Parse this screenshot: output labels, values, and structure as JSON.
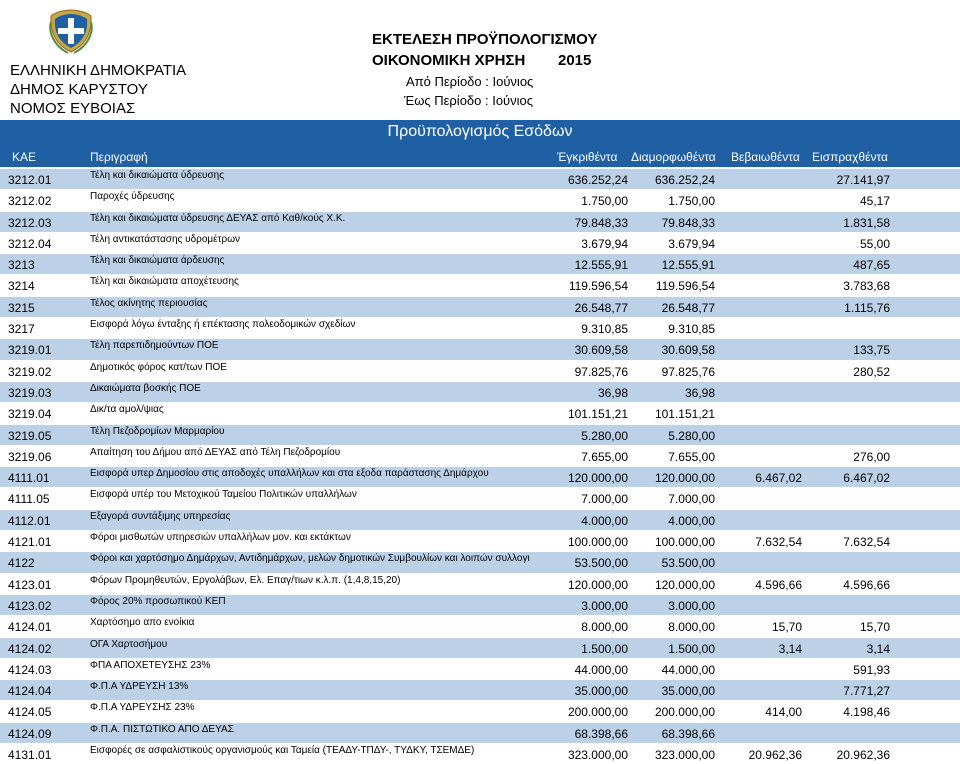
{
  "header": {
    "org_lines": [
      "ΕΛΛΗΝΙΚΗ ΔΗΜΟΚΡΑΤΙΑ",
      "ΔΗΜΟΣ ΚΑΡΥΣΤΟΥ",
      "ΝΟΜΟΣ ΕΥΒΟΙΑΣ"
    ],
    "report_title": "ΕΚΤΕΛΕΣΗ ΠΡΟΫΠΟΛΟΓΙΣΜΟΥ",
    "fiscal_label": "ΟΙΚΟΝΟΜΙΚΗ ΧΡΗΣΗ",
    "year": "2015",
    "from_period": "Από Περίοδο : Ιούνιος",
    "to_period": "Έως Περίοδο : Ιούνιος"
  },
  "section_title": "Προϋπολογισμός Εσόδων",
  "columns": {
    "kae": "ΚΑΕ",
    "description": "Περιγραφή",
    "approved": "Έγκριθέντα",
    "shaped": "Διαμορφωθέντα",
    "confirmed": "Βεβαιωθέντα",
    "collected": "Εισπραχθέντα"
  },
  "colors": {
    "band": "#1f5fa3",
    "alt_row": "#bcd0e7"
  },
  "rows": [
    {
      "kae": "3212.01",
      "desc": "Τέλη και δικαιώματα ύδρευσης",
      "approved": "636.252,24",
      "shaped": "636.252,24",
      "confirmed": "",
      "collected": "27.141,97"
    },
    {
      "kae": "3212.02",
      "desc": "Παροχές ύδρευσης",
      "approved": "1.750,00",
      "shaped": "1.750,00",
      "confirmed": "",
      "collected": "45,17"
    },
    {
      "kae": "3212.03",
      "desc": "Τέλη και δικαιώματα ύδρευσης ΔΕΥΑΣ από Καθ/κούς Χ.Κ.",
      "approved": "79.848,33",
      "shaped": "79.848,33",
      "confirmed": "",
      "collected": "1.831,58"
    },
    {
      "kae": "3212.04",
      "desc": "Τέλη αντικατάστασης υδρομέτρων",
      "approved": "3.679,94",
      "shaped": "3.679,94",
      "confirmed": "",
      "collected": "55,00"
    },
    {
      "kae": "3213",
      "desc": "Τέλη και δικαιώματα άρδευσης",
      "approved": "12.555,91",
      "shaped": "12.555,91",
      "confirmed": "",
      "collected": "487,65"
    },
    {
      "kae": "3214",
      "desc": "Τέλη και δικαιώματα αποχέτευσης",
      "approved": "119.596,54",
      "shaped": "119.596,54",
      "confirmed": "",
      "collected": "3.783,68"
    },
    {
      "kae": "3215",
      "desc": "Τέλος ακίνητης περιουσίας",
      "approved": "26.548,77",
      "shaped": "26.548,77",
      "confirmed": "",
      "collected": "1.115,76"
    },
    {
      "kae": "3217",
      "desc": "Εισφορά λόγω ένταξης ή επέκτασης πολεοδομικών σχεδίων",
      "approved": "9.310,85",
      "shaped": "9.310,85",
      "confirmed": "",
      "collected": ""
    },
    {
      "kae": "3219.01",
      "desc": "Τέλη παρεπιδημούντων ΠΟΕ",
      "approved": "30.609,58",
      "shaped": "30.609,58",
      "confirmed": "",
      "collected": "133,75"
    },
    {
      "kae": "3219.02",
      "desc": "Δημοτικός φόρος κατ/των ΠΟΕ",
      "approved": "97.825,76",
      "shaped": "97.825,76",
      "confirmed": "",
      "collected": "280,52"
    },
    {
      "kae": "3219.03",
      "desc": "Δικαιώματα βοσκής ΠΟΕ",
      "approved": "36,98",
      "shaped": "36,98",
      "confirmed": "",
      "collected": ""
    },
    {
      "kae": "3219.04",
      "desc": "Δικ/τα αμολ/ψιας",
      "approved": "101.151,21",
      "shaped": "101.151,21",
      "confirmed": "",
      "collected": ""
    },
    {
      "kae": "3219.05",
      "desc": "Τέλη Πεζοδρομίων Μαρμαρίου",
      "approved": "5.280,00",
      "shaped": "5.280,00",
      "confirmed": "",
      "collected": ""
    },
    {
      "kae": "3219.06",
      "desc": "Απαίτηση του Δήμου από ΔΕΥΑΣ από Τέλη Πεζοδρομίου",
      "approved": "7.655,00",
      "shaped": "7.655,00",
      "confirmed": "",
      "collected": "276,00"
    },
    {
      "kae": "4111.01",
      "desc": "Εισφορά υπερ Δημοσίου στις αποδοχές υπαλλήλων και στα εξοδα παράστασης Δημάρχου",
      "approved": "120.000,00",
      "shaped": "120.000,00",
      "confirmed": "6.467,02",
      "collected": "6.467,02"
    },
    {
      "kae": "4111.05",
      "desc": "Εισφορά υπέρ του Μετοχικού Ταμείου Πολιτικών υπαλλήλων",
      "approved": "7.000,00",
      "shaped": "7.000,00",
      "confirmed": "",
      "collected": ""
    },
    {
      "kae": "4112.01",
      "desc": "Εξαγορά συντάξιμης υπηρεσίας",
      "approved": "4.000,00",
      "shaped": "4.000,00",
      "confirmed": "",
      "collected": ""
    },
    {
      "kae": "4121.01",
      "desc": "Φόροι μισθωτών υπηρεσιών υπαλλήλων μον. και εκτάκτων",
      "approved": "100.000,00",
      "shaped": "100.000,00",
      "confirmed": "7.632,54",
      "collected": "7.632,54"
    },
    {
      "kae": "4122",
      "desc": "Φόροι και χαρτόσημο Δημάρχων, Αντιδημάρχων, μελών δημοτικών Συμβουλίων και λοιπών συλλογικ",
      "approved": "53.500,00",
      "shaped": "53.500,00",
      "confirmed": "",
      "collected": ""
    },
    {
      "kae": "4123.01",
      "desc": "Φόρων Προμηθευτών, Εργολάβων, Ελ. Επαγ/τιων κ.λ.π. (1,4,8,15,20)",
      "approved": "120.000,00",
      "shaped": "120.000,00",
      "confirmed": "4.596,66",
      "collected": "4.596,66"
    },
    {
      "kae": "4123.02",
      "desc": "Φόρος 20% προσωπικού ΚΕΠ",
      "approved": "3.000,00",
      "shaped": "3.000,00",
      "confirmed": "",
      "collected": ""
    },
    {
      "kae": "4124.01",
      "desc": "Χαρτόσημο απο ενοίκια",
      "approved": "8.000,00",
      "shaped": "8.000,00",
      "confirmed": "15,70",
      "collected": "15,70"
    },
    {
      "kae": "4124.02",
      "desc": "ΟΓΑ Χαρτοσήμου",
      "approved": "1.500,00",
      "shaped": "1.500,00",
      "confirmed": "3,14",
      "collected": "3,14"
    },
    {
      "kae": "4124.03",
      "desc": "ΦΠΑ ΑΠΟΧΕΤΕΥΣΗΣ 23%",
      "approved": "44.000,00",
      "shaped": "44.000,00",
      "confirmed": "",
      "collected": "591,93"
    },
    {
      "kae": "4124.04",
      "desc": "Φ.Π.Α ΥΔΡΕΥΣΗ 13%",
      "approved": "35.000,00",
      "shaped": "35.000,00",
      "confirmed": "",
      "collected": "7.771,27"
    },
    {
      "kae": "4124.05",
      "desc": "Φ.Π.Α ΥΔΡΕΥΣΗΣ 23%",
      "approved": "200.000,00",
      "shaped": "200.000,00",
      "confirmed": "414,00",
      "collected": "4.198,46"
    },
    {
      "kae": "4124.09",
      "desc": "Φ.Π.Α. ΠΙΣΤΩΤΙΚΟ ΑΠΟ ΔΕΥΑΣ",
      "approved": "68.398,66",
      "shaped": "68.398,66",
      "confirmed": "",
      "collected": ""
    },
    {
      "kae": "4131.01",
      "desc": "Εισφορές σε ασφαλιστικούς οργανισμούς και Ταμεία (ΤΕΑΔΥ-ΤΠΔΥ-, ΤΥΔΚΥ, ΤΣΕΜΔΕ)",
      "approved": "323.000,00",
      "shaped": "323.000,00",
      "confirmed": "20.962,36",
      "collected": "20.962,36"
    }
  ]
}
